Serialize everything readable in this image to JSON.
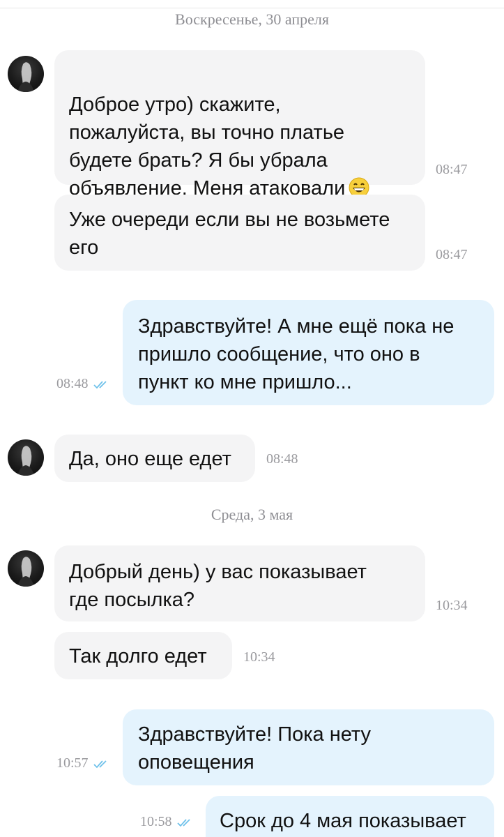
{
  "dates": {
    "first": "Воскресенье, 30 апреля",
    "second": "Среда, 3 мая"
  },
  "messages": [
    {
      "direction": "incoming",
      "text": "Доброе утро) скажите,\nпожалуйста, вы точно платье\nбудете брать? Я бы убрала\nобъявление. Меня атаковали",
      "emoji": "grinning-face-emoji",
      "time": "08:47"
    },
    {
      "direction": "incoming",
      "text": "Уже очереди если вы не возьмете\nего",
      "time": "08:47"
    },
    {
      "direction": "outgoing",
      "text": "Здравствуйте! А мне ещё пока не\nпришло сообщение,  что оно в\nпункт ко мне пришло...",
      "time": "08:48",
      "status_icon": "double-check-icon"
    },
    {
      "direction": "incoming",
      "text": "Да, оно еще едет",
      "time": "08:48"
    },
    {
      "direction": "incoming",
      "text": "Добрый день) у вас показывает\nгде посылка?",
      "time": "10:34"
    },
    {
      "direction": "incoming",
      "text": "Так долго едет",
      "time": "10:34"
    },
    {
      "direction": "outgoing",
      "text": "Здравствуйте! Пока нету\nоповещения",
      "time": "10:57",
      "status_icon": "double-check-icon"
    },
    {
      "direction": "outgoing",
      "text": "Срок до 4 мая показывает",
      "time": "10:58",
      "status_icon": "double-check-icon"
    }
  ],
  "colors": {
    "incoming_bubble": "#f4f4f5",
    "outgoing_bubble": "#e4f3fd",
    "read_check": "#6ec1ea",
    "meta_text": "#9a9a9e"
  }
}
